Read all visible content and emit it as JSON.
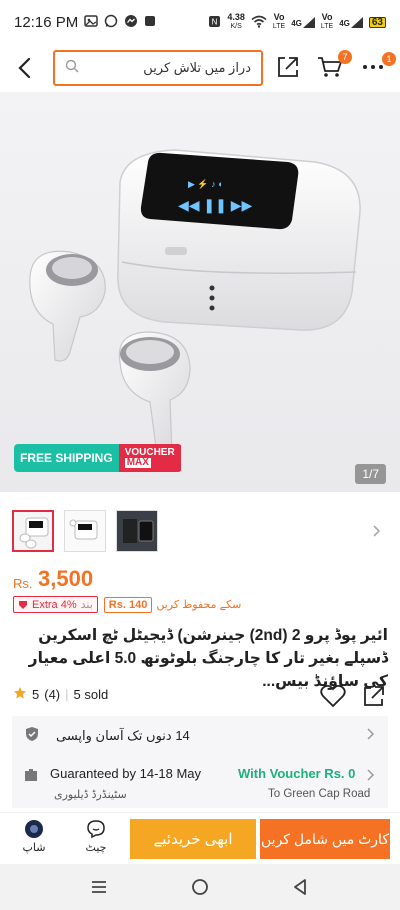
{
  "status_bar": {
    "time": "12:16 PM",
    "net_speed": "4.38",
    "net_unit": "K/S",
    "vo1": "Vo",
    "lte1": "LTE",
    "sig1": "4G",
    "vo2": "Vo",
    "lte2": "LTE",
    "sig2": "4G",
    "battery": "63"
  },
  "header": {
    "search_placeholder": "دراز میں تلاش کریں",
    "cart_count": "7",
    "more_count": "1"
  },
  "hero": {
    "shipping_label": "FREE SHIPPING",
    "voucher_line1": "VOUCHER",
    "voucher_line2": "MAX",
    "pager": "1/7"
  },
  "price": {
    "currency": "Rs.",
    "amount": "3,500"
  },
  "promos": {
    "extra_label": "Extra 4%",
    "extra_suffix": "بند",
    "save_amount": "Rs. 140",
    "save_label": "سکے محفوظ کریں"
  },
  "product": {
    "title": "ائیر پوڈ پرو 2 (2nd) جینرشن) ڈیجیٹل ٹچ اسکرین ڈسپلے بغیر تار کا چارجنگ بلوٹوتھ 5.0 اعلی معیار کی ساؤنڈ بیس..."
  },
  "rating": {
    "score": "5",
    "count": "(4)",
    "sold": "5 sold"
  },
  "returns": {
    "label": "14 دنوں تک آسان واپسی"
  },
  "delivery": {
    "guarantee": "Guaranteed by 14-18 May",
    "voucher_label": "With Voucher Rs. 0",
    "standard": "سٹینڈرڈ ڈیلیوری",
    "location": "To Green Cap Road"
  },
  "bottom": {
    "shop": "شاپ",
    "chat": "چیٹ",
    "buy_now": "ابھی خریدئیے",
    "add_to_cart": "کارٹ میں شامل کریں"
  },
  "colors": {
    "accent": "#f57224",
    "buy": "#f5a623",
    "teal": "#1bbfa4",
    "red": "#e32b45",
    "green": "#1bb17a"
  }
}
